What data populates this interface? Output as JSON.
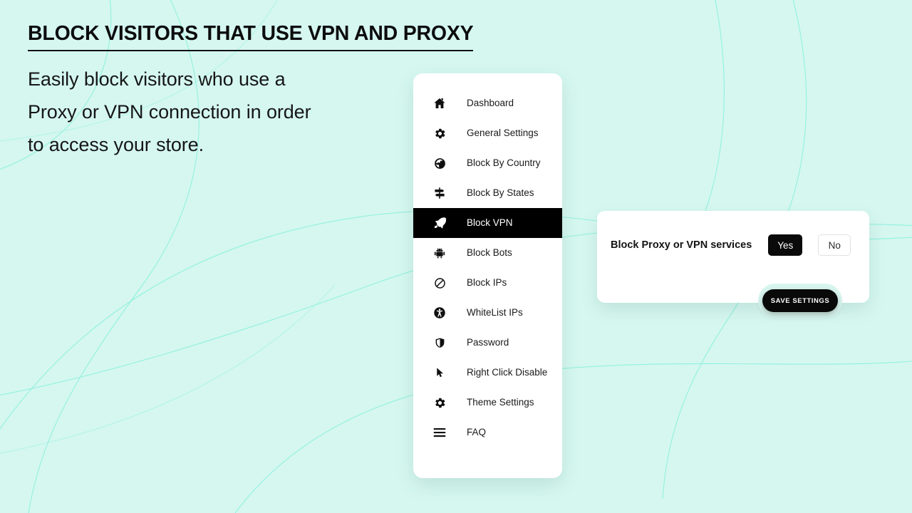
{
  "theme": {
    "background": "#d5f7f0",
    "curve_stroke": "#7defd8",
    "card_bg": "#ffffff",
    "active_bg": "#000000",
    "text": "#1a1a1a"
  },
  "promo": {
    "title": "BLOCK VISITORS THAT USE VPN AND PROXY",
    "subtitle_lines": [
      "Easily block visitors who use a",
      "Proxy or VPN connection in order",
      "to access your store."
    ]
  },
  "sidebar": {
    "items": [
      {
        "label": "Dashboard",
        "icon": "home-icon",
        "active": false
      },
      {
        "label": "General Settings",
        "icon": "gear-icon",
        "active": false
      },
      {
        "label": "Block By Country",
        "icon": "globe-icon",
        "active": false
      },
      {
        "label": "Block By States",
        "icon": "signpost-icon",
        "active": false
      },
      {
        "label": "Block VPN",
        "icon": "rocket-icon",
        "active": true
      },
      {
        "label": "Block Bots",
        "icon": "robot-icon",
        "active": false
      },
      {
        "label": "Block IPs",
        "icon": "ban-icon",
        "active": false
      },
      {
        "label": "WhiteList IPs",
        "icon": "accessibility-icon",
        "active": false
      },
      {
        "label": "Password",
        "icon": "shield-icon",
        "active": false
      },
      {
        "label": "Right Click Disable",
        "icon": "cursor-arrow-icon",
        "active": false
      },
      {
        "label": "Theme Settings",
        "icon": "gear-icon",
        "active": false
      },
      {
        "label": "FAQ",
        "icon": "hamburger-icon",
        "active": false
      }
    ]
  },
  "panel": {
    "label": "Block Proxy or VPN services",
    "options": {
      "yes_label": "Yes",
      "no_label": "No",
      "selected": "Yes"
    },
    "save_label": "SAVE SETTINGS"
  }
}
